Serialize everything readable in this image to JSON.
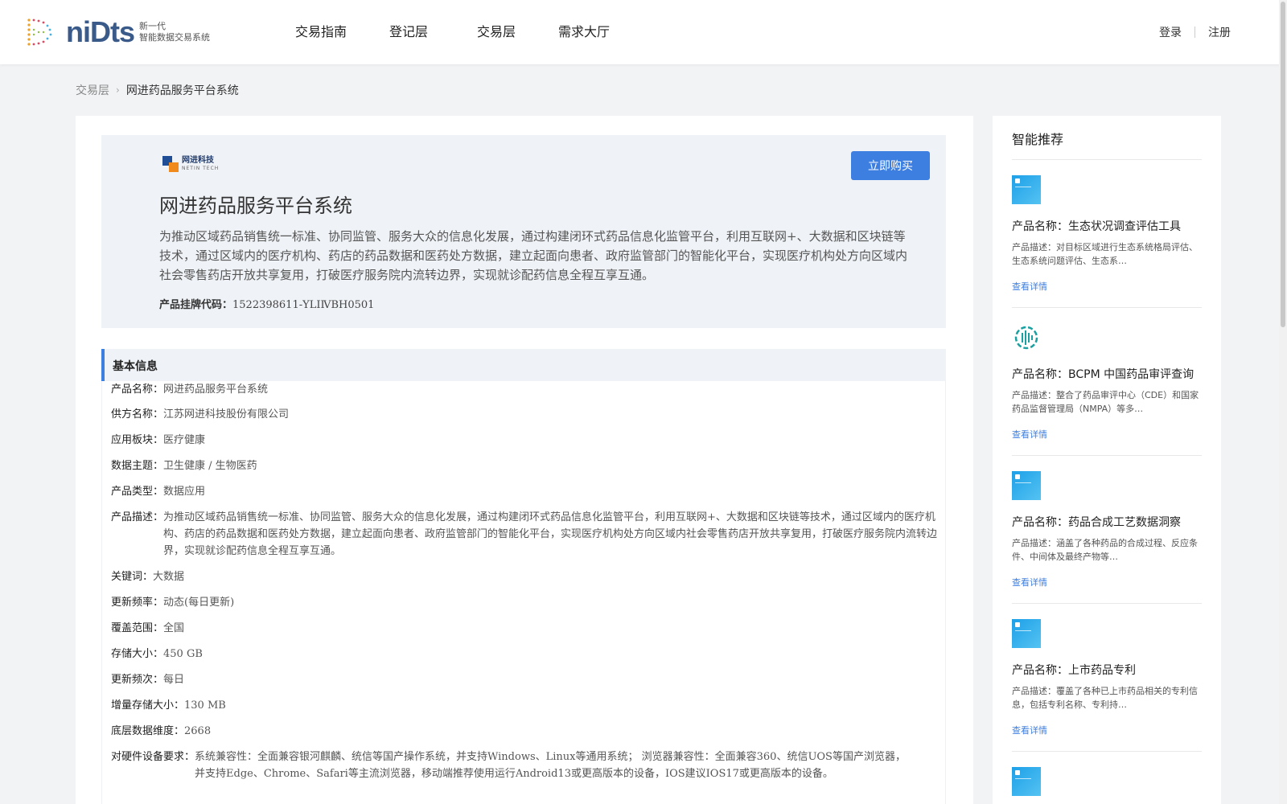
{
  "header": {
    "logo_word": "niDts",
    "logo_sub_line1": "新一代",
    "logo_sub_line2": "智能数据交易系统",
    "nav": [
      "交易指南",
      "登记层",
      "交易层",
      "需求大厅"
    ],
    "login": "登录",
    "register": "注册"
  },
  "breadcrumb": {
    "home": "交易层",
    "current": "网进药品服务平台系统"
  },
  "hero": {
    "vendor_name": "网进科技",
    "vendor_sub": "NETIN TECH",
    "buy_label": "立即购买",
    "title": "网进药品服务平台系统",
    "description": "为推动区域药品销售统一标准、协同监管、服务大众的信息化发展，通过构建闭环式药品信息化监管平台，利用互联网+、大数据和区块链等技术，通过区域内的医疗机构、药店的药品数据和医药处方数据，建立起面向患者、政府监管部门的智能化平台，实现医疗机构处方向区域内社会零售药店开放共享复用，打破医疗服务院内流转边界，实现就诊配药信息全程互享互通。",
    "code_label": "产品挂牌代码：",
    "code_value": "1522398611-YLIⅣBH0501"
  },
  "basic_info": {
    "section_title": "基本信息",
    "fields": [
      {
        "k": "产品名称：",
        "v": "网进药品服务平台系统"
      },
      {
        "k": "供方名称：",
        "v": "江苏网进科技股份有限公司"
      },
      {
        "k": "应用板块：",
        "v": "医疗健康"
      },
      {
        "k": "数据主题：",
        "v": "卫生健康 / 生物医药"
      },
      {
        "k": "产品类型：",
        "v": "数据应用"
      },
      {
        "k": "产品描述：",
        "v": "为推动区域药品销售统一标准、协同监管、服务大众的信息化发展，通过构建闭环式药品信息化监管平台，利用互联网+、大数据和区块链等技术，通过区域内的医疗机构、药店的药品数据和医药处方数据，建立起面向患者、政府监管部门的智能化平台，实现医疗机构处方向区域内社会零售药店开放共享复用，打破医疗服务院内流转边界，实现就诊配药信息全程互享互通。"
      },
      {
        "k": "关键词：",
        "v": "大数据"
      },
      {
        "k": "更新频率：",
        "v": "动态(每日更新)"
      },
      {
        "k": "覆盖范围：",
        "v": "全国"
      },
      {
        "k": "存储大小：",
        "v": "450 GB"
      },
      {
        "k": "更新频次：",
        "v": "每日"
      },
      {
        "k": "增量存储大小：",
        "v": "130 MB"
      },
      {
        "k": "底层数据维度：",
        "v": "2668"
      },
      {
        "k": "对硬件设备要求：",
        "v": "系统兼容性：全面兼容银河麒麟、统信等国产操作系统，并支持Windows、Linux等通用系统； 浏览器兼容性：全面兼容360、统信UOS等国产浏览器，并支持Edge、Chrome、Safari等主流浏览器，移动端推荐使用运行Android13或更高版本的设备，IOS建议IOS17或更高版本的设备。"
      }
    ]
  },
  "sidebar": {
    "title": "智能推荐",
    "items": [
      {
        "name": "产品名称：生态状况调查评估工具",
        "desc": "产品描述：对目标区域进行生态系统格局评估、生态系统问题评估、生态系…",
        "link": "查看详情"
      },
      {
        "name": "产品名称：BCPM 中国药品审评查询",
        "desc": "产品描述：整合了药品审评中心（CDE）和国家药品监督管理局（NMPA）等多…",
        "link": "查看详情"
      },
      {
        "name": "产品名称：药品合成工艺数据洞察",
        "desc": "产品描述：涵盖了各种药品的合成过程、反应条件、中间体及最终产物等…",
        "link": "查看详情"
      },
      {
        "name": "产品名称：上市药品专利",
        "desc": "产品描述：覆盖了各种已上市药品相关的专利信息，包括专利名称、专利持…",
        "link": "查看详情"
      }
    ]
  },
  "colors": {
    "accent": "#3d7fe0",
    "hero_bg": "#eff2f6",
    "page_bg": "#f2f3f5"
  }
}
